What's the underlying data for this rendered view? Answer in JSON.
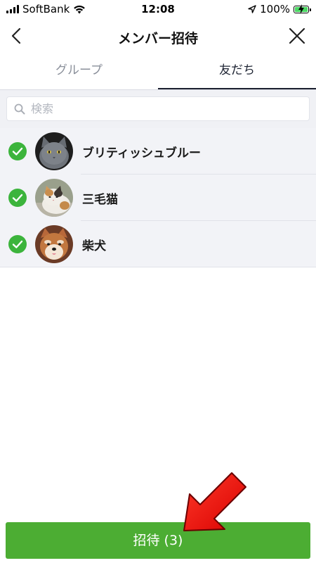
{
  "status_bar": {
    "carrier": "SoftBank",
    "time": "12:08",
    "battery": "100%"
  },
  "header": {
    "title": "メンバー招待"
  },
  "tabs": [
    {
      "label": "グループ",
      "active": false
    },
    {
      "label": "友だち",
      "active": true
    }
  ],
  "search": {
    "placeholder": "検索",
    "value": ""
  },
  "friends": [
    {
      "name": "ブリティッシュブルー",
      "selected": true,
      "avatar": "gray-cat"
    },
    {
      "name": "三毛猫",
      "selected": true,
      "avatar": "calico-cat"
    },
    {
      "name": "柴犬",
      "selected": true,
      "avatar": "shiba-dog"
    }
  ],
  "invite_button": {
    "label": "招待 (3)"
  },
  "colors": {
    "accent_green": "#4cad33",
    "check_green": "#3cb43c",
    "annotation_red": "#e60000"
  }
}
